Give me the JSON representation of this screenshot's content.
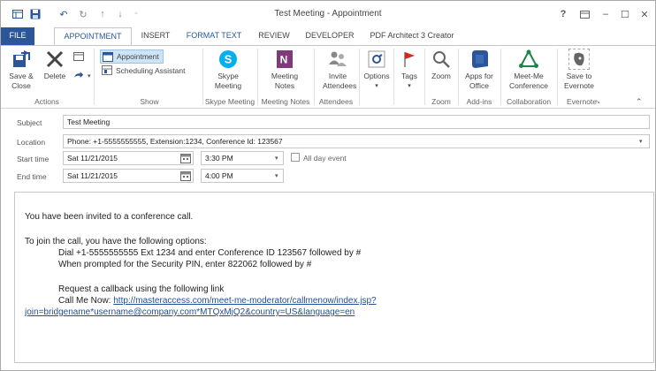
{
  "window": {
    "title": "Test Meeting - Appointment",
    "help": "?",
    "minimize": "–",
    "maximize": "☐",
    "close": "✕"
  },
  "tabs": [
    {
      "label": "FILE"
    },
    {
      "label": "APPOINTMENT"
    },
    {
      "label": "INSERT"
    },
    {
      "label": "FORMAT TEXT"
    },
    {
      "label": "REVIEW"
    },
    {
      "label": "DEVELOPER"
    },
    {
      "label": "PDF Architect 3 Creator"
    }
  ],
  "ribbon": {
    "actions": {
      "save_close": "Save & Close",
      "delete": "Delete",
      "group": "Actions"
    },
    "show": {
      "appointment": "Appointment",
      "scheduling": "Scheduling Assistant",
      "group": "Show"
    },
    "skype": {
      "label": "Skype Meeting",
      "group": "Skype Meeting"
    },
    "meeting_notes": {
      "label": "Meeting Notes",
      "group": "Meeting Notes"
    },
    "attendees": {
      "label": "Invite Attendees",
      "group": "Attendees"
    },
    "options": {
      "label": "Options"
    },
    "tags": {
      "label": "Tags"
    },
    "zoom": {
      "label": "Zoom",
      "group": "Zoom"
    },
    "addins": {
      "label": "Apps for Office",
      "group": "Add-ins"
    },
    "collab": {
      "label": "Meet-Me Conference",
      "group": "Collaboration"
    },
    "evernote": {
      "label": "Save to Evernote",
      "group": "Evernote"
    }
  },
  "form": {
    "subject_label": "Subject",
    "subject_value": "Test Meeting",
    "location_label": "Location",
    "location_value": "Phone: +1-5555555555, Extension:1234, Conference Id: 123567",
    "start_label": "Start time",
    "start_date": "Sat 11/21/2015",
    "start_time": "3:30 PM",
    "all_day": "All day event",
    "end_label": "End time",
    "end_date": "Sat 11/21/2015",
    "end_time": "4:00 PM"
  },
  "body": {
    "line1": "You have been invited to a conference call.",
    "line2": "To join the call, you have the following options:",
    "line3": "Dial +1-5555555555 Ext 1234 and enter Conference ID 123567 followed by #",
    "line4": "When prompted for the Security PIN, enter 822062 followed by #",
    "line5": "Request a callback using the following link",
    "line6_prefix": "Call Me Now: ",
    "link_part1": "http://masteraccess.com/meet-me-moderator/callmenow/index.jsp?",
    "link_part2": "join=bridgename*username@company.com*MTQxMjQ2&country=US&language=en"
  },
  "colors": {
    "accent": "#2b579a",
    "link": "#1f4e9b"
  }
}
